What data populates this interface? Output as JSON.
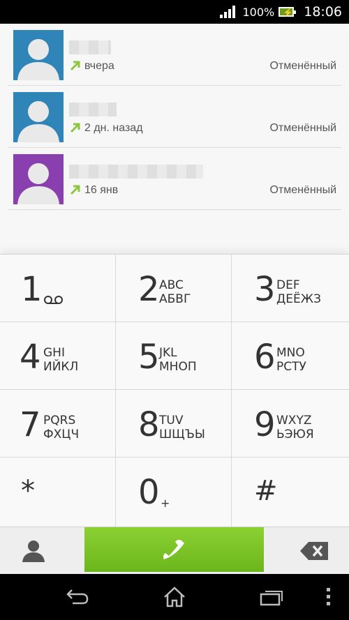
{
  "status_bar": {
    "battery_percent": "100%",
    "time": "18:06",
    "signal_icon": "signal-full-icon",
    "battery_icon": "battery-charging-icon"
  },
  "call_log": [
    {
      "time": "вчера",
      "status": "Отменённый",
      "avatar_color": "#2f84b8",
      "direction": "outgoing"
    },
    {
      "time": "2 дн. назад",
      "status": "Отменённый",
      "avatar_color": "#2f84b8",
      "direction": "outgoing"
    },
    {
      "time": "16 янв",
      "status": "Отменённый",
      "avatar_color": "#8a3fae",
      "direction": "outgoing"
    }
  ],
  "dialpad": {
    "keys": [
      {
        "digit": "1",
        "letters_latin": "",
        "letters_cyr": ""
      },
      {
        "digit": "2",
        "letters_latin": "ABC",
        "letters_cyr": "АБВГ"
      },
      {
        "digit": "3",
        "letters_latin": "DEF",
        "letters_cyr": "ДЕЁЖЗ"
      },
      {
        "digit": "4",
        "letters_latin": "GHI",
        "letters_cyr": "ИЙКЛ"
      },
      {
        "digit": "5",
        "letters_latin": "JKL",
        "letters_cyr": "МНОП"
      },
      {
        "digit": "6",
        "letters_latin": "MNO",
        "letters_cyr": "РСТУ"
      },
      {
        "digit": "7",
        "letters_latin": "PQRS",
        "letters_cyr": "ФХЦЧ"
      },
      {
        "digit": "8",
        "letters_latin": "TUV",
        "letters_cyr": "ШЩЪЫ"
      },
      {
        "digit": "9",
        "letters_latin": "WXYZ",
        "letters_cyr": "ЬЭЮЯ"
      },
      {
        "digit": "*",
        "letters_latin": "",
        "letters_cyr": ""
      },
      {
        "digit": "0",
        "letters_latin": "+",
        "letters_cyr": ""
      },
      {
        "digit": "#",
        "letters_latin": "",
        "letters_cyr": ""
      }
    ]
  },
  "action_bar": {
    "contacts_icon": "contact-person-icon",
    "call_icon": "phone-handset-icon",
    "backspace_icon": "backspace-icon",
    "call_color": "#7cc326"
  },
  "nav_bar": {
    "back_icon": "back-icon",
    "home_icon": "home-icon",
    "recents_icon": "recent-apps-icon",
    "menu_icon": "overflow-menu-icon"
  },
  "colors": {
    "accent_arrow": "#8cc63f"
  }
}
